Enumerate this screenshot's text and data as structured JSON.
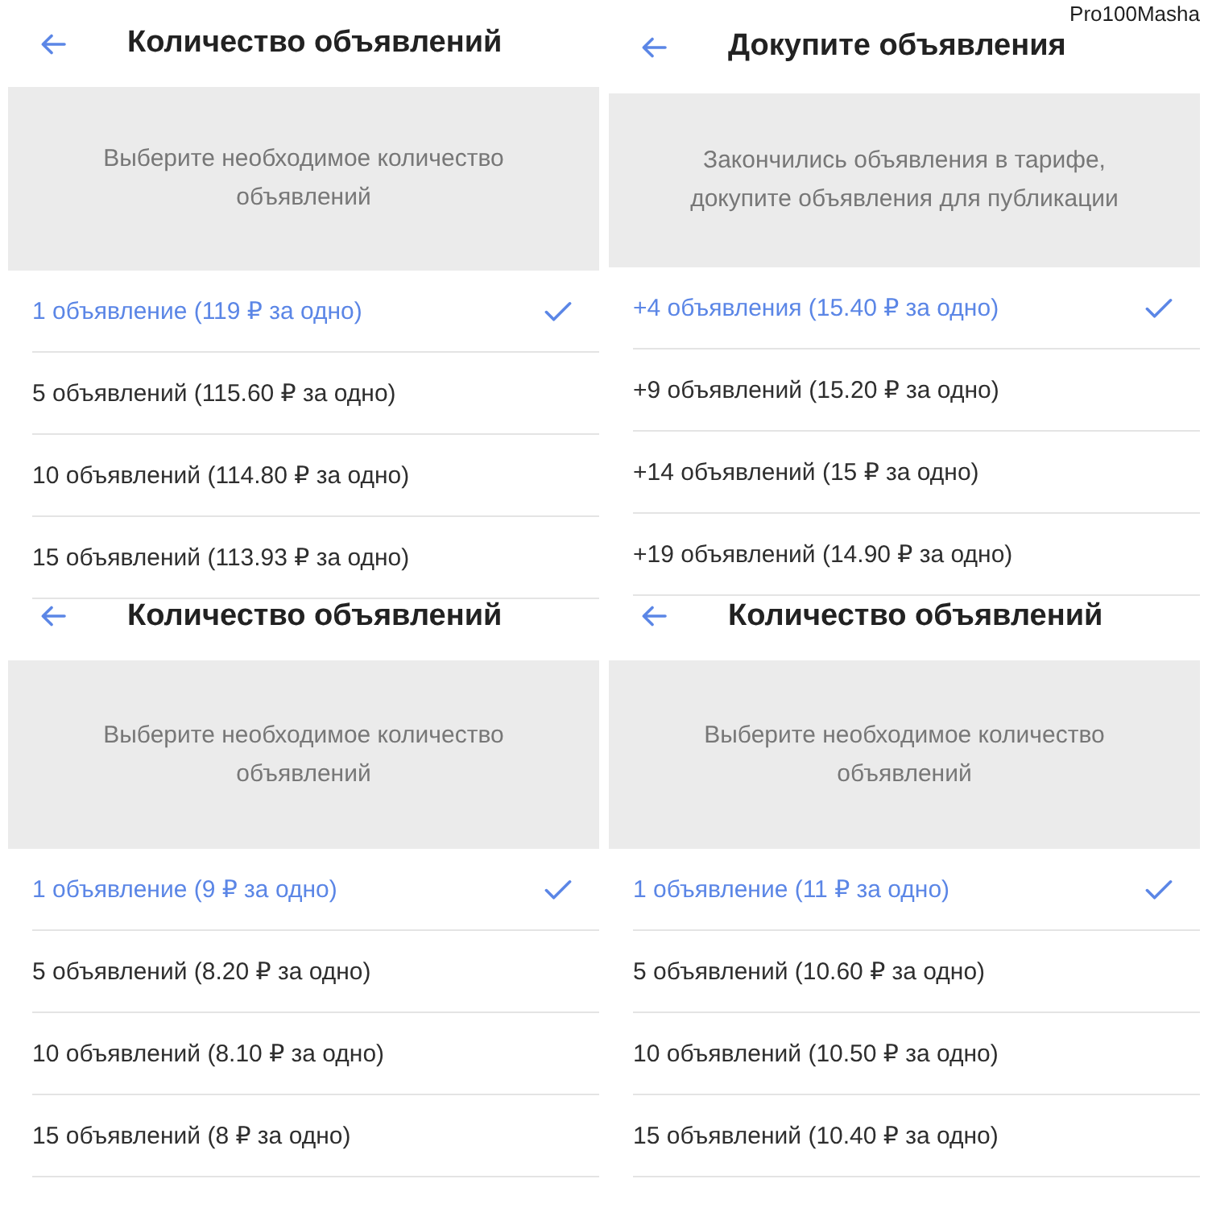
{
  "author_tag": "Pro100Masha",
  "screens": [
    {
      "title": "Количество объявлений",
      "message": "Выберите необходимое количество объявлений",
      "options": [
        {
          "label": "1 объявление (119 ₽ за одно)",
          "selected": true
        },
        {
          "label": "5 объявлений (115.60 ₽ за одно)",
          "selected": false
        },
        {
          "label": "10 объявлений (114.80 ₽ за одно)",
          "selected": false
        },
        {
          "label": "15 объявлений (113.93 ₽ за одно)",
          "selected": false
        }
      ]
    },
    {
      "title": "Докупите объявления",
      "message": "Закончились объявления в тарифе, докупите объявления для публикации",
      "options": [
        {
          "label": "+4 объявления (15.40 ₽ за одно)",
          "selected": true
        },
        {
          "label": "+9 объявлений (15.20 ₽ за одно)",
          "selected": false
        },
        {
          "label": "+14 объявлений (15 ₽ за одно)",
          "selected": false
        },
        {
          "label": "+19 объявлений (14.90 ₽ за одно)",
          "selected": false
        }
      ]
    },
    {
      "title": "Количество объявлений",
      "message": "Выберите необходимое количество объявлений",
      "options": [
        {
          "label": "1 объявление (9 ₽ за одно)",
          "selected": true
        },
        {
          "label": "5 объявлений (8.20 ₽ за одно)",
          "selected": false
        },
        {
          "label": "10 объявлений (8.10 ₽ за одно)",
          "selected": false
        },
        {
          "label": "15 объявлений (8 ₽ за одно)",
          "selected": false
        }
      ]
    },
    {
      "title": "Количество объявлений",
      "message": "Выберите необходимое количество объявлений",
      "options": [
        {
          "label": "1 объявление (11 ₽ за одно)",
          "selected": true
        },
        {
          "label": "5 объявлений (10.60 ₽ за одно)",
          "selected": false
        },
        {
          "label": "10 объявлений (10.50 ₽ за одно)",
          "selected": false
        },
        {
          "label": "15 объявлений (10.40 ₽ за одно)",
          "selected": false
        }
      ]
    }
  ]
}
